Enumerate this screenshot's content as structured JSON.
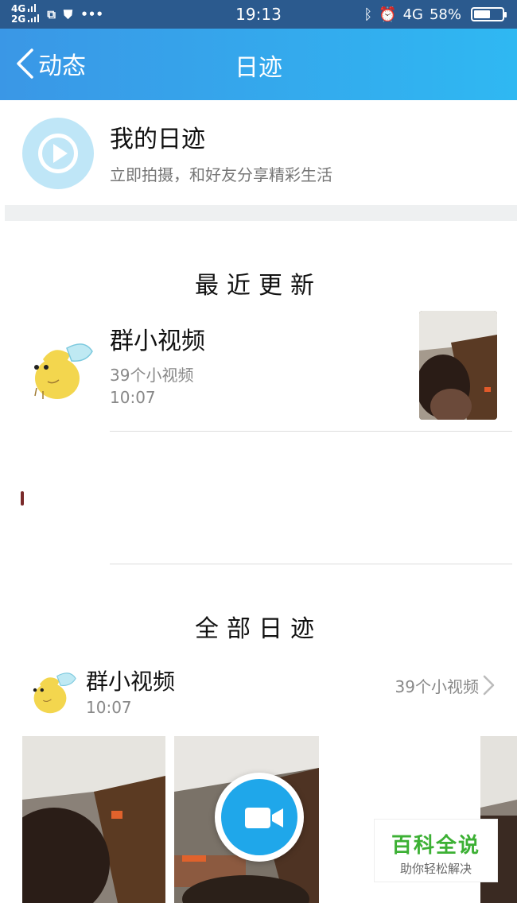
{
  "status_bar": {
    "net1": "4G",
    "net2": "2G",
    "time": "19:13",
    "net_right": "4G",
    "battery": "58%",
    "battery_level": 0.58
  },
  "nav": {
    "back_label": "动态",
    "title": "日迹"
  },
  "my_diary": {
    "title": "我的日迹",
    "subtitle": "立即拍摄，和好友分享精彩生活"
  },
  "recent": {
    "section_title": "最近更新",
    "item": {
      "name": "群小视频",
      "count": "39个小视频",
      "time": "10:07"
    }
  },
  "all": {
    "section_title": "全部日迹",
    "item": {
      "name": "群小视频",
      "time": "10:07",
      "count": "39个小视频"
    }
  },
  "watermark": {
    "title": "百科全说",
    "subtitle": "助你轻松解决"
  },
  "colors": {
    "nav_start": "#3a97e6",
    "nav_end": "#2fb8f2",
    "accent": "#1fa7ea",
    "watermark": "#3cb034"
  }
}
